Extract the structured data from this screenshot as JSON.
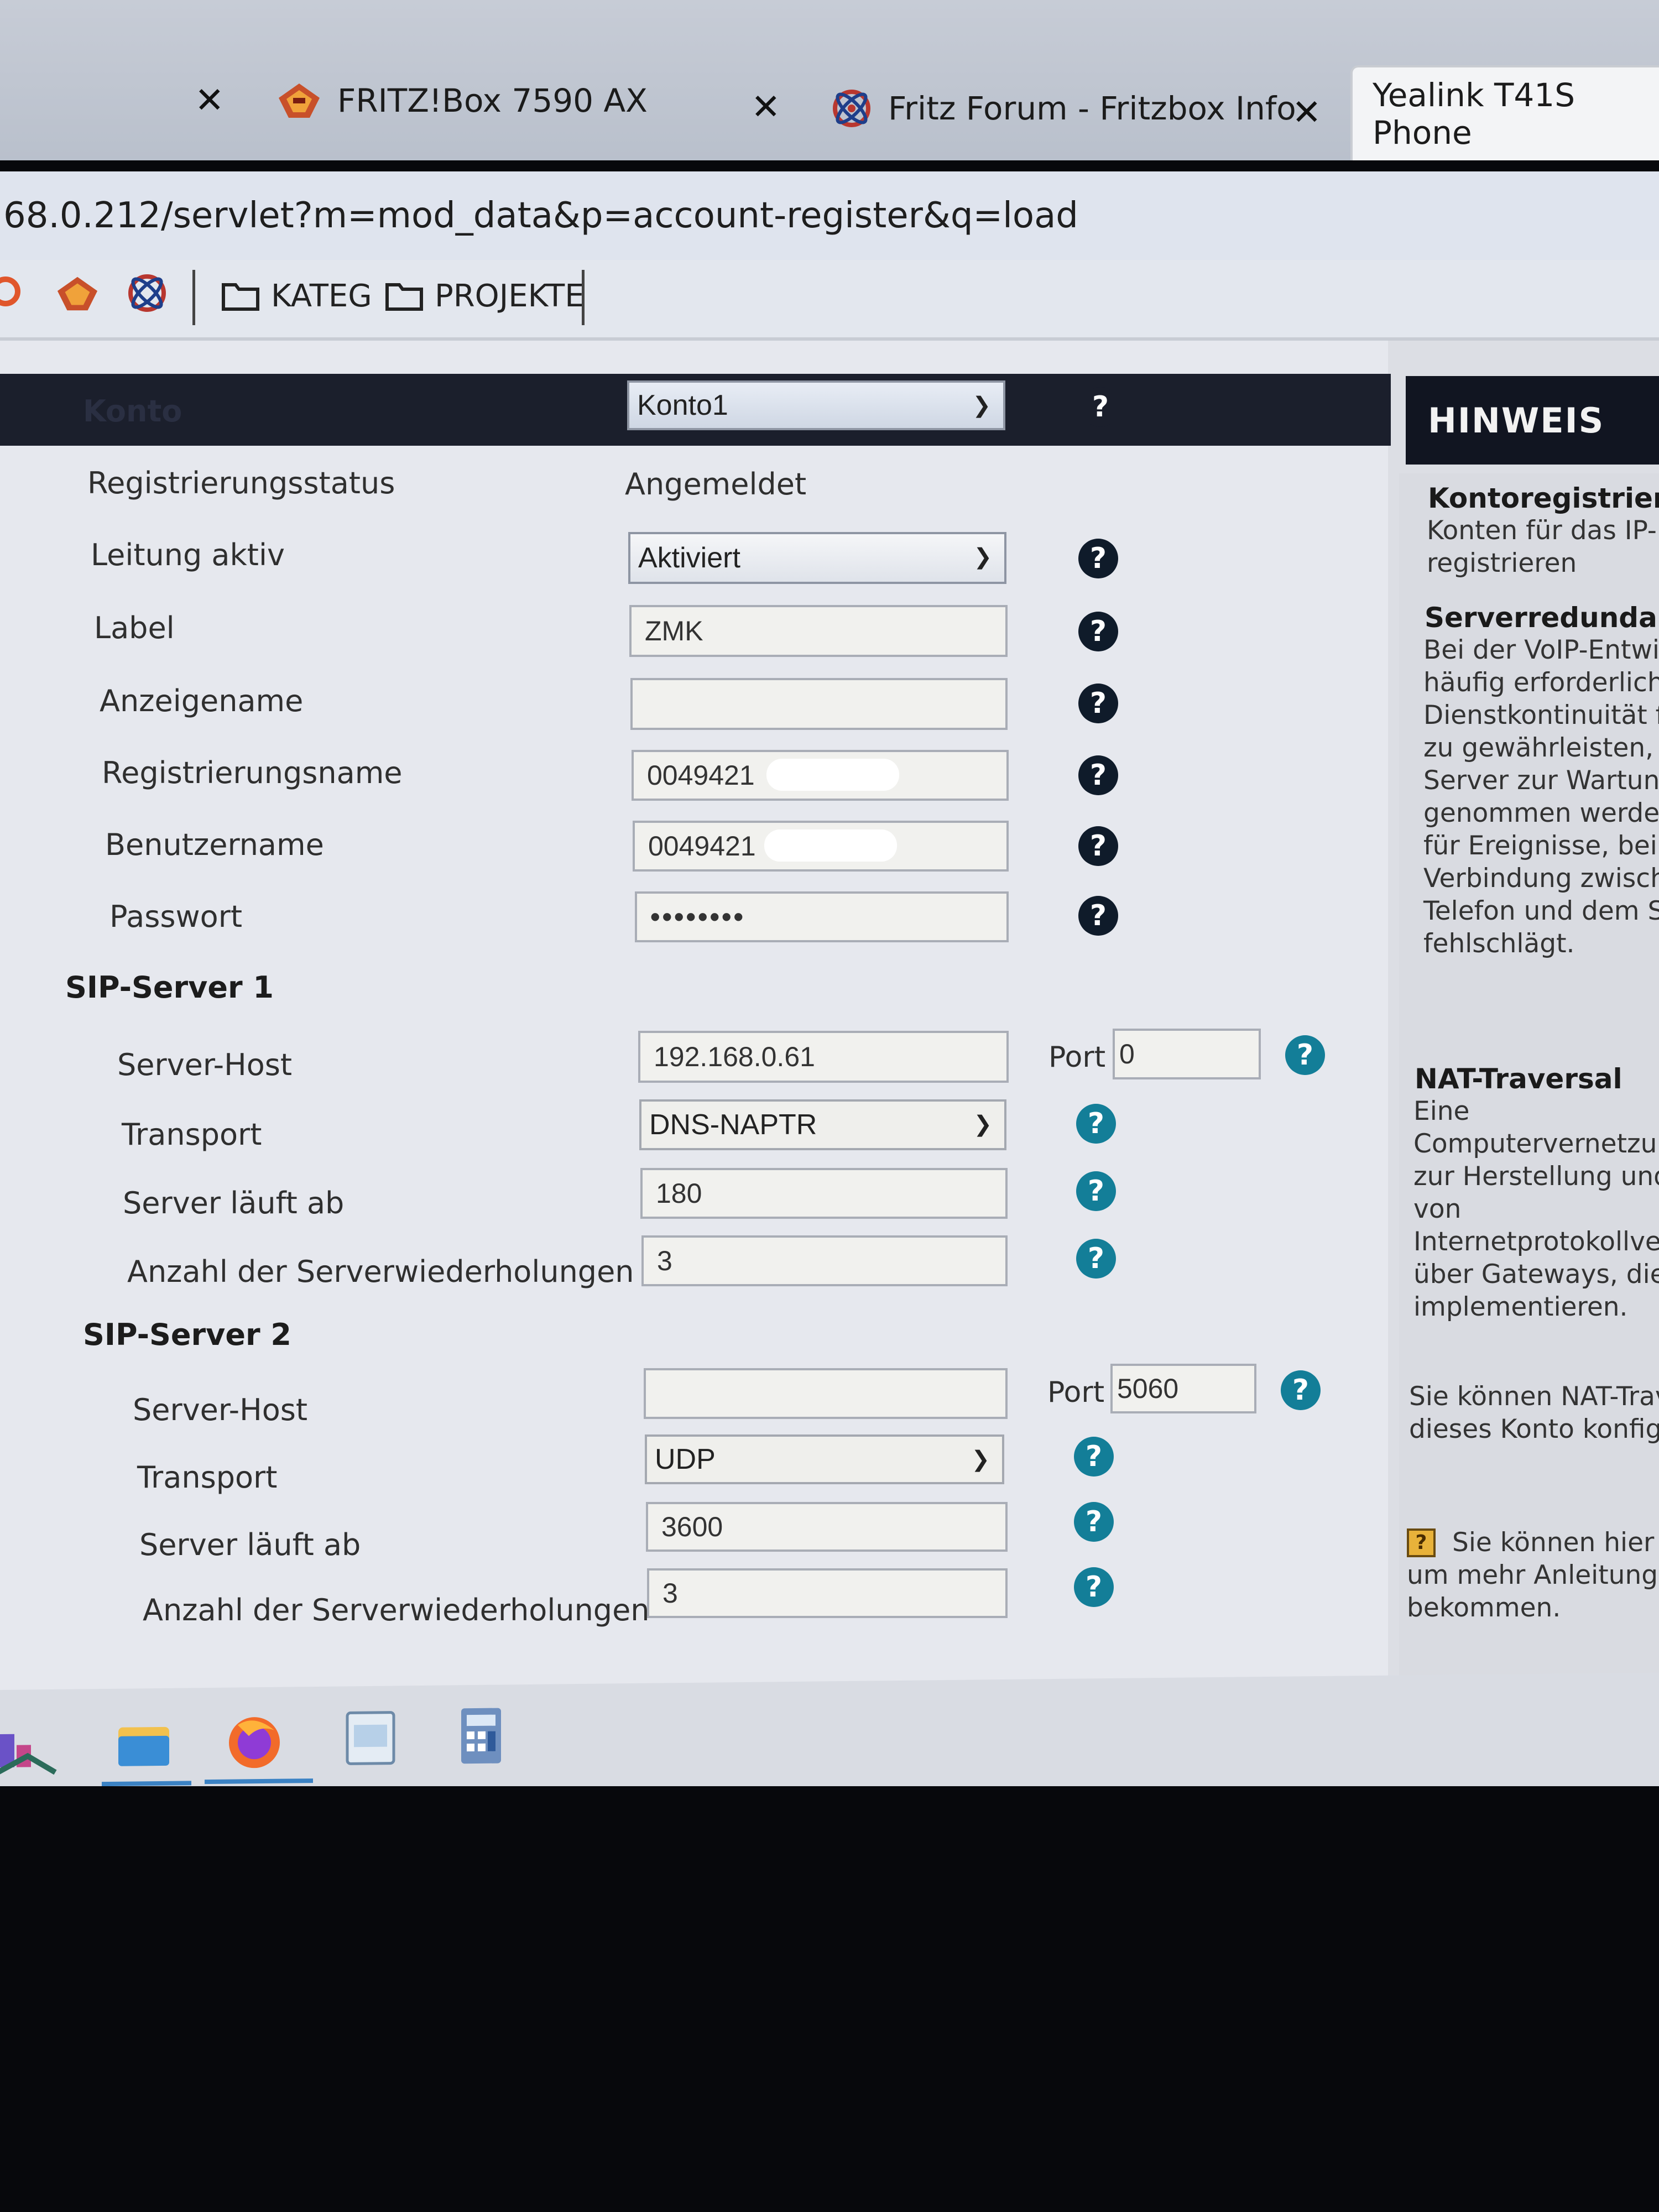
{
  "tabs": [
    {
      "label": "FRITZ!Box 7590 AX",
      "icon": "fritzbox-icon"
    },
    {
      "label": "Fritz Forum - Fritzbox Info",
      "icon": "fritz-forum-icon"
    },
    {
      "label": "Yealink T41S Phone",
      "active": true
    }
  ],
  "url": "68.0.212/servlet?m=mod_data&p=account-register&q=load",
  "bookmarks": [
    {
      "label": "KATEG",
      "icon": "folder-icon"
    },
    {
      "label": "PROJEKTE",
      "icon": "folder-icon"
    }
  ],
  "form": {
    "konto_label": "Konto",
    "konto_value": "Konto1",
    "rows": {
      "registrierungsstatus": {
        "label": "Registrierungsstatus",
        "value": "Angemeldet"
      },
      "leitung_aktiv": {
        "label": "Leitung aktiv",
        "value": "Aktiviert"
      },
      "label": {
        "label": "Label",
        "value": "ZMK"
      },
      "anzeigename": {
        "label": "Anzeigename",
        "value": ""
      },
      "registrierungsname": {
        "label": "Registrierungsname",
        "value": "0049421"
      },
      "benutzername": {
        "label": "Benutzername",
        "value": "0049421"
      },
      "passwort": {
        "label": "Passwort",
        "value": "••••••••"
      }
    },
    "sip1": {
      "title": "SIP-Server 1",
      "server_host_label": "Server-Host",
      "server_host": "192.168.0.61",
      "port_label": "Port",
      "port": "0",
      "transport_label": "Transport",
      "transport": "DNS-NAPTR",
      "expires_label": "Server läuft ab",
      "expires": "180",
      "retries_label": "Anzahl der Serverwiederholungen",
      "retries": "3"
    },
    "sip2": {
      "title": "SIP-Server 2",
      "server_host_label": "Server-Host",
      "server_host": "",
      "port_label": "Port",
      "port": "5060",
      "transport_label": "Transport",
      "transport": "UDP",
      "expires_label": "Server läuft ab",
      "expires": "3600",
      "retries_label": "Anzahl der Serverwiederholungen",
      "retries": "3"
    }
  },
  "hint": {
    "title": "HINWEIS",
    "sec1_title": "Kontoregistrieru",
    "sec1_lines": [
      "Konten für das IP-",
      "registrieren"
    ],
    "sec2_title": "Serverredundanz",
    "sec2_lines": [
      "Bei der VoIP-Entwi",
      "häufig erforderlich,",
      "Dienstkontinuität fü",
      "zu gewährleisten, b",
      "Server zur Wartung",
      "genommen werden",
      "für Ereignisse, bei d",
      "Verbindung zwische",
      "Telefon und dem Se",
      "fehlschlägt."
    ],
    "sec3_title": "NAT-Traversal",
    "sec3_lines": [
      "Eine",
      "Computervernetzung",
      "zur Herstellung und",
      "von",
      "Internetprotokollverb",
      "über Gateways, die N",
      "implementieren."
    ],
    "sec4_lines": [
      "Sie können NAT-Trav",
      "dieses Konto konfigu"
    ],
    "sec5_lines": [
      "Sie können hier",
      "um mehr Anleitunge",
      "bekommen."
    ]
  },
  "colors": {
    "help_icon": "#137e98",
    "header_bar": "#1b1f2c"
  }
}
